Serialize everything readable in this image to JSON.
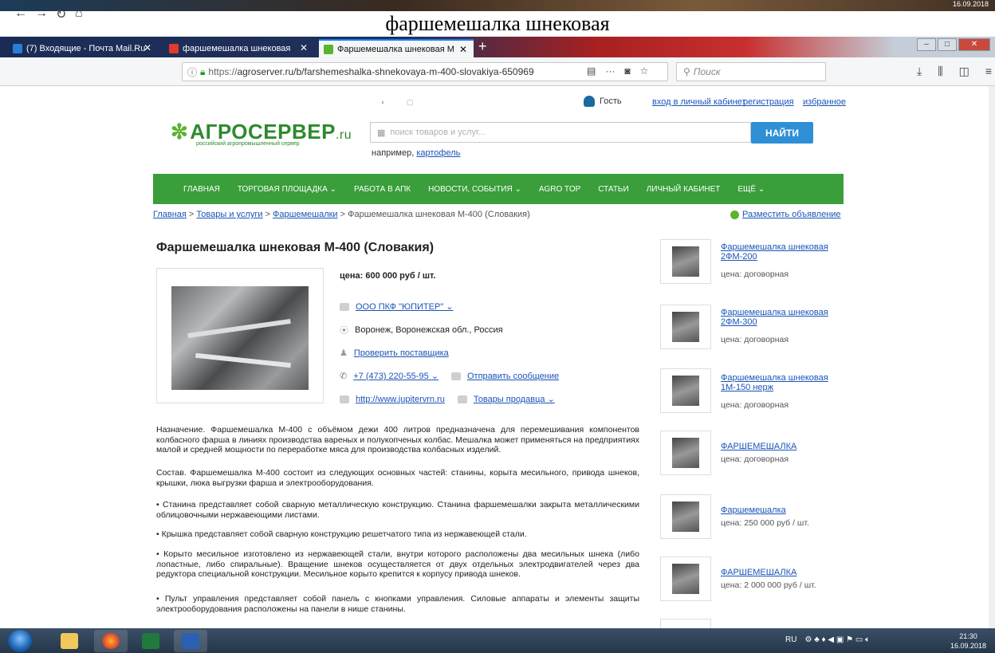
{
  "top_strip": {
    "date": "16.09.2018"
  },
  "caption": "фаршемешалка шнековая",
  "browser": {
    "tabs": [
      {
        "label": "(7) Входящие - Почта Mail.Ru",
        "active": false
      },
      {
        "label": "фаршемешалка шнековая",
        "active": false
      },
      {
        "label": "Фаршемешалка шнековая М",
        "active": true
      }
    ],
    "url_scheme": "https://",
    "url": "agroserver.ru/b/farshemeshalka-shnekovaya-m-400-slovakiya-650969",
    "search_placeholder": "Поиск"
  },
  "site": {
    "guest": "Гость",
    "login": "вход в личный кабинет",
    "register": "регистрация",
    "favorites": "избранное",
    "logo_name": "АГРОСЕРВЕР",
    "logo_tld": ".ru",
    "logo_tagline": "российский агропромышленный сервер",
    "search_placeholder": "поиск товаров и услуг...",
    "find_button": "НАЙТИ",
    "example_prefix": "например,",
    "example_link": "картофель",
    "nav": [
      "ГЛАВНАЯ",
      "ТОРГОВАЯ ПЛОЩАДКА ⌄",
      "РАБОТА В АПК",
      "НОВОСТИ, СОБЫТИЯ ⌄",
      "AGRO TOP",
      "СТАТЬИ",
      "ЛИЧНЫЙ КАБИНЕТ",
      "ЕЩЁ ⌄"
    ],
    "breadcrumbs": [
      "Главная",
      "Товары и услуги",
      "Фаршемешалки"
    ],
    "breadcrumb_current": "Фаршемешалка шнековая М-400 (Словакия)",
    "post_ad": "Разместить объявление"
  },
  "product": {
    "title": "Фаршемешалка шнековая М-400 (Словакия)",
    "price": "цена: 600 000 руб / шт.",
    "company": "ООО ПКФ \"ЮПИТЕР\" ⌄",
    "location": "Воронеж, Воронежская обл., Россия",
    "check_supplier": "Проверить поставщика",
    "phone": "+7 (473) 220-55-95 ⌄",
    "send_message": "Отправить сообщение",
    "website": "http://www.jupitervrn.ru",
    "seller_goods": "Товары продавца ⌄",
    "description": [
      "Назначение. Фаршемешалка М-400 с объёмом дежи 400 литров предназначена для перемешивания компонентов колбасного фарша в линиях производства вареных и полукопченых колбас. Мешалка может применяться на предприятиях малой и средней мощности по переработке мяса для производства колбасных изделий.",
      "Состав. Фаршемешалка М-400 состоит из следующих основных частей: станины, корыта месильного, привода шнеков, крышки, люка выгрузки фарша и электрооборудования.",
      "• Станина представляет собой сварную металлическую конструкцию. Станина фаршемешалки закрыта металлическими облицовочными нержавеющими листами.",
      "• Крышка представляет собой сварную конструкцию решетчатого типа из нержавеющей стали.",
      "• Корыто месильное изготовлено из нержавеющей стали, внутри которого расположены два месильных шнека (либо лопастные, либо спиральные). Вращение шнеков осуществляется от двух отдельных электродвигателей через два редуктора специальной конструкции. Месильное корыто крепится к корпусу привода шнеков.",
      "• Пульт управления представляет собой панель с кнопками управления. Силовые аппараты и элементы защиты электрооборудования расположены на панели в нише станины."
    ]
  },
  "related": [
    {
      "title": "Фаршемешалка шнековая 2ФМ-200",
      "price": "цена: договорная"
    },
    {
      "title": "Фаршемешалка шнековая 2ФМ-300",
      "price": "цена: договорная"
    },
    {
      "title": "Фаршемешалка шнековая 1М-150 нерж",
      "price": "цена: договорная"
    },
    {
      "title": "ФАРШЕМЕШАЛКА",
      "price": "цена: договорная"
    },
    {
      "title": "Фаршемешалка",
      "price": "цена: 250 000 руб / шт."
    },
    {
      "title": "ФАРШЕМЕШАЛКА",
      "price": "цена: 2 000 000 руб / шт."
    }
  ],
  "taskbar": {
    "lang": "RU",
    "time": "21:30",
    "date": "16.09.2018"
  }
}
